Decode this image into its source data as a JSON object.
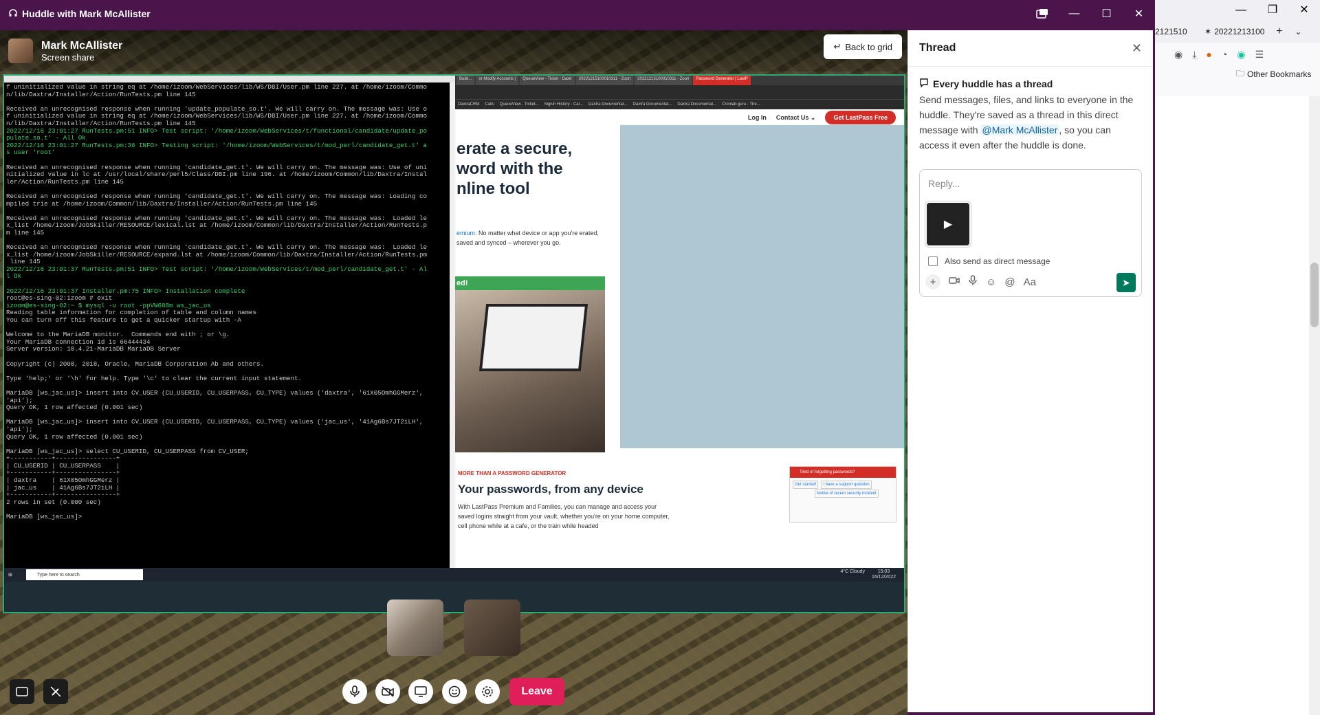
{
  "window": {
    "title": "Huddle with Mark McAllister",
    "controls": [
      "minimize",
      "maximize",
      "close"
    ]
  },
  "presenter": {
    "name": "Mark McAllister",
    "status": "Screen share"
  },
  "back_button_label": "Back to grid",
  "shared_screen": {
    "terminal_lines": [
      {
        "t": "f uninitialized value in string eq at /home/izoom/WebServices/lib/WS/DBI/User.pm line 227. at /home/izoom/Commo",
        "c": ""
      },
      {
        "t": "n/lib/Daxtra/Installer/Action/RunTests.pm line 145",
        "c": ""
      },
      {
        "t": "",
        "c": ""
      },
      {
        "t": "Received an unrecognised response when running 'update_populate_so.t'. We will carry on. The message was: Use o",
        "c": ""
      },
      {
        "t": "f uninitialized value in string eq at /home/izoom/WebServices/lib/WS/DBI/User.pm line 227. at /home/izoom/Commo",
        "c": ""
      },
      {
        "t": "n/lib/Daxtra/Installer/Action/RunTests.pm line 145",
        "c": ""
      },
      {
        "t": "2022/12/16 23:01:27 RunTests.pm:51 INFO> Test script: '/home/izoom/WebServices/t/functional/candidate/update_po",
        "c": "g"
      },
      {
        "t": "pulate_so.t' - All Ok",
        "c": "g"
      },
      {
        "t": "2022/12/16 23:01:27 RunTests.pm:36 INFO> Testing script: '/home/izoom/WebServices/t/mod_perl/candidate_get.t' a",
        "c": "g"
      },
      {
        "t": "s user 'root'",
        "c": "g"
      },
      {
        "t": "",
        "c": ""
      },
      {
        "t": "Received an unrecognised response when running 'candidate_get.t'. We will carry on. The message was: Use of uni",
        "c": ""
      },
      {
        "t": "nitialized value in lc at /usr/local/share/perl5/Class/DBI.pm line 196. at /home/izoom/Common/lib/Daxtra/Instal",
        "c": ""
      },
      {
        "t": "ler/Action/RunTests.pm line 145",
        "c": ""
      },
      {
        "t": "",
        "c": ""
      },
      {
        "t": "Received an unrecognised response when running 'candidate_get.t'. We will carry on. The message was: Loading co",
        "c": ""
      },
      {
        "t": "mpiled trie at /home/izoom/Common/lib/Daxtra/Installer/Action/RunTests.pm line 145",
        "c": ""
      },
      {
        "t": "",
        "c": ""
      },
      {
        "t": "Received an unrecognised response when running 'candidate_get.t'. We will carry on. The message was:  Loaded le",
        "c": ""
      },
      {
        "t": "x_list /home/izoom/JobSkiller/RESOURCE/lexical.lst at /home/izoom/Common/lib/Daxtra/Installer/Action/RunTests.p",
        "c": ""
      },
      {
        "t": "m line 145",
        "c": ""
      },
      {
        "t": "",
        "c": ""
      },
      {
        "t": "Received an unrecognised response when running 'candidate_get.t'. We will carry on. The message was:  Loaded le",
        "c": ""
      },
      {
        "t": "x_list /home/izoom/JobSkiller/RESOURCE/expand.lst at /home/izoom/Common/lib/Daxtra/Installer/Action/RunTests.pm",
        "c": ""
      },
      {
        "t": " line 145",
        "c": ""
      },
      {
        "t": "2022/12/16 23:01:37 RunTests.pm:51 INFO> Test script: '/home/izoom/WebServices/t/mod_perl/candidate_get.t' - Al",
        "c": "g"
      },
      {
        "t": "l Ok",
        "c": "g"
      },
      {
        "t": "",
        "c": ""
      },
      {
        "t": "2022/12/16 23:01:37 Installer.pm:75 INFO> Installation complete",
        "c": "g"
      },
      {
        "t": "root@es-sing-02:izoom # exit",
        "c": ""
      },
      {
        "t": "izoom@es-sing-02:~ $ mysql -u root -ppVW688m ws_jac_us",
        "c": "g"
      },
      {
        "t": "Reading table information for completion of table and column names",
        "c": ""
      },
      {
        "t": "You can turn off this feature to get a quicker startup with -A",
        "c": ""
      },
      {
        "t": "",
        "c": ""
      },
      {
        "t": "Welcome to the MariaDB monitor.  Commands end with ; or \\g.",
        "c": ""
      },
      {
        "t": "Your MariaDB connection id is 66444434",
        "c": ""
      },
      {
        "t": "Server version: 10.4.21-MariaDB MariaDB Server",
        "c": ""
      },
      {
        "t": "",
        "c": ""
      },
      {
        "t": "Copyright (c) 2000, 2018, Oracle, MariaDB Corporation Ab and others.",
        "c": ""
      },
      {
        "t": "",
        "c": ""
      },
      {
        "t": "Type 'help;' or '\\h' for help. Type '\\c' to clear the current input statement.",
        "c": ""
      },
      {
        "t": "",
        "c": ""
      },
      {
        "t": "MariaDB [ws_jac_us]> insert into CV_USER (CU_USERID, CU_USERPASS, CU_TYPE) values ('daxtra', '61X05OmhGGMerz',",
        "c": ""
      },
      {
        "t": "'api');",
        "c": ""
      },
      {
        "t": "Query OK, 1 row affected (0.001 sec)",
        "c": ""
      },
      {
        "t": "",
        "c": ""
      },
      {
        "t": "MariaDB [ws_jac_us]> insert into CV_USER (CU_USERID, CU_USERPASS, CU_TYPE) values ('jac_us', '41Ag6Bs7JT2iLH',",
        "c": ""
      },
      {
        "t": "'api');",
        "c": ""
      },
      {
        "t": "Query OK, 1 row affected (0.001 sec)",
        "c": ""
      },
      {
        "t": "",
        "c": ""
      },
      {
        "t": "MariaDB [ws_jac_us]> select CU_USERID, CU_USERPASS from CV_USER;",
        "c": ""
      },
      {
        "t": "+-----------+----------------+",
        "c": ""
      },
      {
        "t": "| CU_USERID | CU_USERPASS    |",
        "c": ""
      },
      {
        "t": "+-----------+----------------+",
        "c": ""
      },
      {
        "t": "| daxtra    | 61X05OmhGGMerz |",
        "c": ""
      },
      {
        "t": "| jac_us    | 41Ag6Bs7JT2iLH |",
        "c": ""
      },
      {
        "t": "+-----------+----------------+",
        "c": ""
      },
      {
        "t": "2 rows in set (0.000 sec)",
        "c": ""
      },
      {
        "t": "",
        "c": ""
      },
      {
        "t": "MariaDB [ws_jac_us]> ",
        "c": ""
      }
    ],
    "browser_tabs": [
      "Build...",
      "or Modify Accounts |",
      "QueueView - Ticket - Daxtr",
      "20221215100010311 - Zoon",
      "20221215100010311 - Zoon",
      "Password Generator | LastP"
    ],
    "bookmarks": [
      "DaxtraCRM",
      "Calls",
      "QueueView - Ticket...",
      "Signin History - Cal...",
      "Daxtra Documentat...",
      "Daxtra Documentat...",
      "Daxtra Documentat...",
      "Crontab.guru - The..."
    ],
    "lastpass": {
      "nav": [
        "Log In",
        "Contact Us ⌄",
        "Get LastPass Free"
      ],
      "hero_lines": [
        "erate a secure,",
        "word with the",
        "nline tool"
      ],
      "hero_sub_prefix": "emium",
      "hero_sub": ". No matter what device or app you're erated, saved and synced – wherever you go.",
      "green_banner": "ed!",
      "section_kicker": "MORE THAN A PASSWORD GENERATOR",
      "section_title": "Your passwords, from any device",
      "section_body": "With LastPass Premium and Families, you can manage and access your saved logins straight from your vault, whether you're on your home computer, cell phone while at a cafe, or the train while headed",
      "chat_title": "Tired of forgetting passwords?",
      "chat_btn1": "Get started!",
      "chat_btn2": "I have a support question",
      "chat_btn3": "Notice of recent security incident"
    },
    "taskbar": {
      "search_placeholder": "Type here to search",
      "weather": "4°C  Cloudy",
      "time": "15:03",
      "date": "16/12/2022"
    }
  },
  "controls": {
    "leave_label": "Leave"
  },
  "thread": {
    "title": "Thread",
    "info_title": "Every huddle has a thread",
    "info_body_1": "Send messages, files, and links to everyone in the huddle. They're saved as a thread in this direct message with ",
    "mention": "@Mark McAllister",
    "info_body_2": ", so you can access it even after the huddle is done.",
    "reply_placeholder": "Reply...",
    "also_send_label": "Also send as direct message"
  },
  "right_browser": {
    "tab1": "2121510",
    "tab2": "20221213100",
    "other_bookmarks": "Other Bookmarks"
  },
  "colors": {
    "slack_aubergine": "#4a154b",
    "leave_red": "#e01e5a",
    "send_green": "#007a5a",
    "screen_border": "#2bac76",
    "lastpass_red": "#d32d27"
  }
}
